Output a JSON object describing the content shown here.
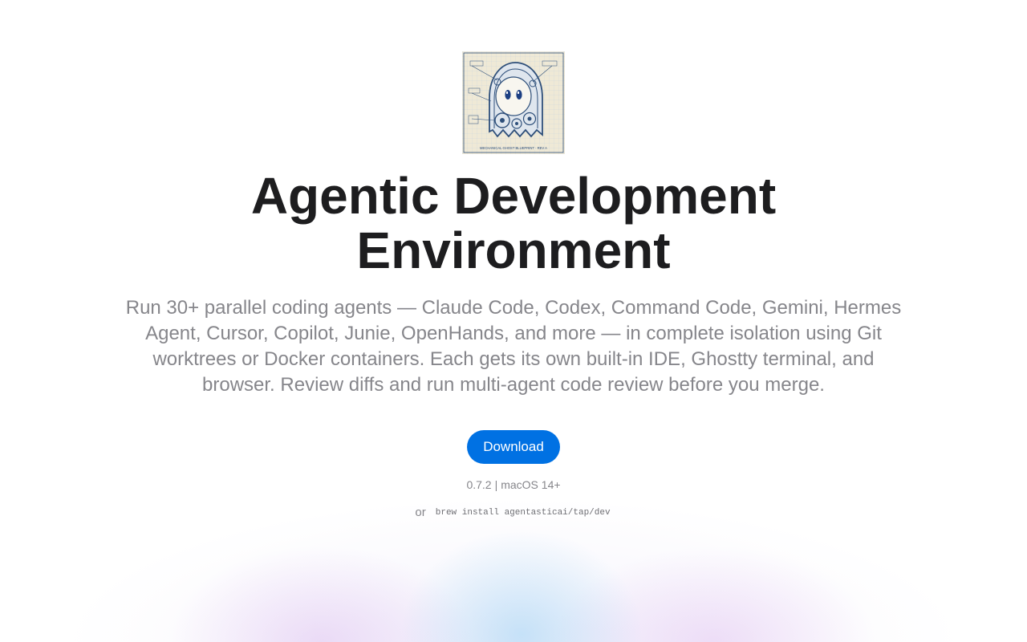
{
  "logo": {
    "icon": "mechanical-ghost-blueprint-icon",
    "caption": "MECHANICAL GHOST BLUEPRINT · REV A",
    "colors": {
      "paper": "#efe9d6",
      "ink": "#2e4f7a",
      "eye": "#1c3f82"
    }
  },
  "hero": {
    "title": "Agentic Development Environment",
    "subtitle": "Run 30+ parallel coding agents — Claude Code, Codex, Command Code, Gemini, Hermes Agent, Cursor, Copilot, Junie, OpenHands, and more — in complete isolation using Git worktrees or Docker containers. Each gets its own built-in IDE, Ghostty terminal, and browser. Review diffs and run multi-agent code review before you merge."
  },
  "download": {
    "label": "Download",
    "color": "#0071e3"
  },
  "version": {
    "number": "0.7.2",
    "separator": "|",
    "platform": "macOS 14+"
  },
  "brew": {
    "or_label": "or",
    "command": "brew install agentasticai/tap/dev"
  }
}
